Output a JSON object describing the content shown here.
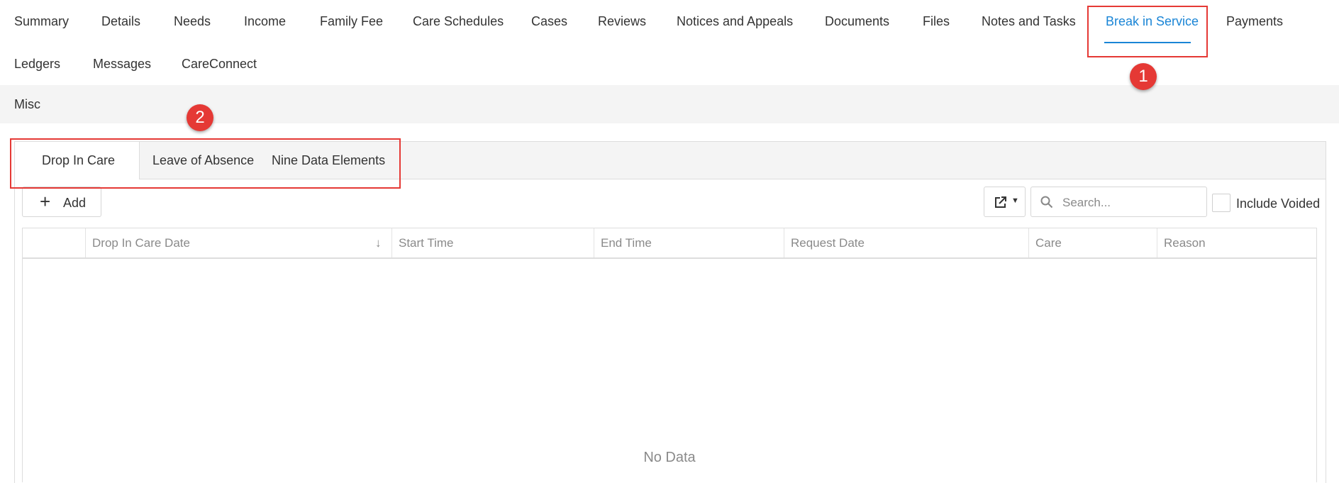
{
  "nav": {
    "tabs_row1": [
      "Summary",
      "Details",
      "Needs",
      "Income",
      "Family Fee",
      "Care Schedules",
      "Cases",
      "Reviews",
      "Notices and Appeals",
      "Documents",
      "Files",
      "Notes and Tasks",
      "Break in Service",
      "Payments"
    ],
    "tabs_row2": [
      "Ledgers",
      "Messages",
      "CareConnect"
    ],
    "active_tab": "Break in Service",
    "misc_label": "Misc"
  },
  "subtabs": {
    "items": [
      "Drop In Care",
      "Leave of Absence",
      "Nine Data Elements"
    ],
    "active": "Drop In Care"
  },
  "toolbar": {
    "add_label": "Add",
    "export_icon": "export-icon",
    "search_placeholder": "Search...",
    "search_value": "",
    "include_voided_label": "Include Voided",
    "include_voided_checked": false
  },
  "grid": {
    "columns": [
      "",
      "Drop In Care Date",
      "Start Time",
      "End Time",
      "Request Date",
      "Care",
      "Reason"
    ],
    "sorted_column": "Drop In Care Date",
    "sort_direction": "descending",
    "rows": [],
    "empty_text": "No Data"
  },
  "callouts": [
    "1",
    "2"
  ],
  "colors": {
    "accent": "#1a85d6",
    "callout_red": "#e53935"
  }
}
